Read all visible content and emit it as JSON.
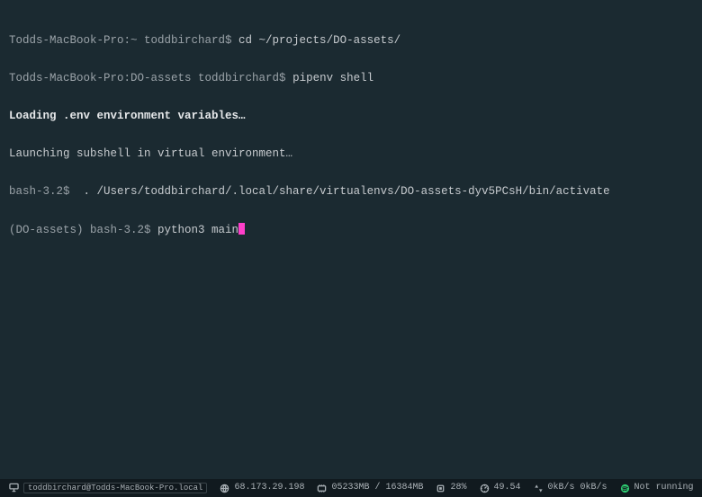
{
  "lines": {
    "l1_prompt": "Todds-MacBook-Pro:~ toddbirchard$ ",
    "l1_cmd": "cd ~/projects/DO-assets/",
    "l2_prompt": "Todds-MacBook-Pro:DO-assets toddbirchard$ ",
    "l2_cmd": "pipenv shell",
    "l3_msg": "Loading .env environment variables…",
    "l4_msg": "Launching subshell in virtual environment…",
    "l5_prompt": "bash-3.2$  ",
    "l5_cmd": ". /Users/toddbirchard/.local/share/virtualenvs/DO-assets-dyv5PCsH/bin/activate",
    "l6_prompt": "(DO-assets) bash-3.2$ ",
    "l6_cmd": "python3 main"
  },
  "status": {
    "host": "toddbirchard@Todds-MacBook-Pro.local",
    "ip": "68.173.29.198",
    "mem": "05233MB / 16384MB",
    "cpu": "28%",
    "temp": "49.54",
    "net": "0kB/s 0kB/s",
    "spotify": "Not running"
  }
}
